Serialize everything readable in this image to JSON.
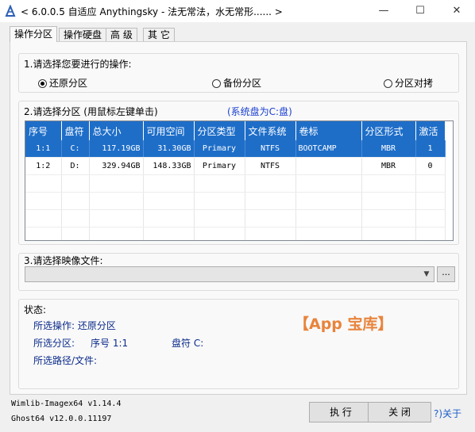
{
  "window": {
    "title": "< 6.0.0.5 自适应 Anythingsky - 法无常法，水无常形...... >",
    "min_glyph": "—",
    "max_glyph": "☐",
    "close_glyph": "✕"
  },
  "tabs": [
    "操作分区",
    "操作硬盘",
    "高 级",
    "其 它"
  ],
  "operation": {
    "label": "1.请选择您要进行的操作:",
    "options": [
      {
        "label": "还原分区",
        "selected": true
      },
      {
        "label": "备份分区",
        "selected": false
      },
      {
        "label": "分区对拷",
        "selected": false
      }
    ]
  },
  "partition": {
    "label": "2.请选择分区 (用鼠标左键单击)",
    "system_disk": "(系统盘为C:盘)",
    "columns": [
      "序号",
      "盘符",
      "总大小",
      "可用空间",
      "分区类型",
      "文件系统",
      "卷标",
      "分区形式",
      "激活"
    ],
    "rows": [
      {
        "index": "1:1",
        "drive": "C:",
        "total": "117.19GB",
        "free": "31.30GB",
        "type": "Primary",
        "fs": "NTFS",
        "volume": "BOOTCAMP",
        "form": "MBR",
        "active": "1",
        "selected": true
      },
      {
        "index": "1:2",
        "drive": "D:",
        "total": "329.94GB",
        "free": "148.33GB",
        "type": "Primary",
        "fs": "NTFS",
        "volume": "",
        "form": "MBR",
        "active": "0",
        "selected": false
      }
    ]
  },
  "image": {
    "label": "3.请选择映像文件:",
    "value": "",
    "browse_label": "..."
  },
  "status": {
    "label": "状态:",
    "operation_line": "所选操作: 还原分区",
    "partition_prefix": "所选分区:",
    "partition_index": "序号 1:1",
    "drive": "盘符 C:",
    "path_line": "所选路径/文件:"
  },
  "watermark": "【App 宝库】",
  "footer": {
    "wimlib": "Wimlib-Imagex64 v1.14.4",
    "ghost": "Ghost64 v12.0.0.11197",
    "execute": "执 行",
    "close": "关 闭",
    "about": "?)关于"
  },
  "colors": {
    "accent": "#1e6ec8",
    "system_disk_text": "#1a3fd0",
    "watermark": "#e8843c"
  }
}
